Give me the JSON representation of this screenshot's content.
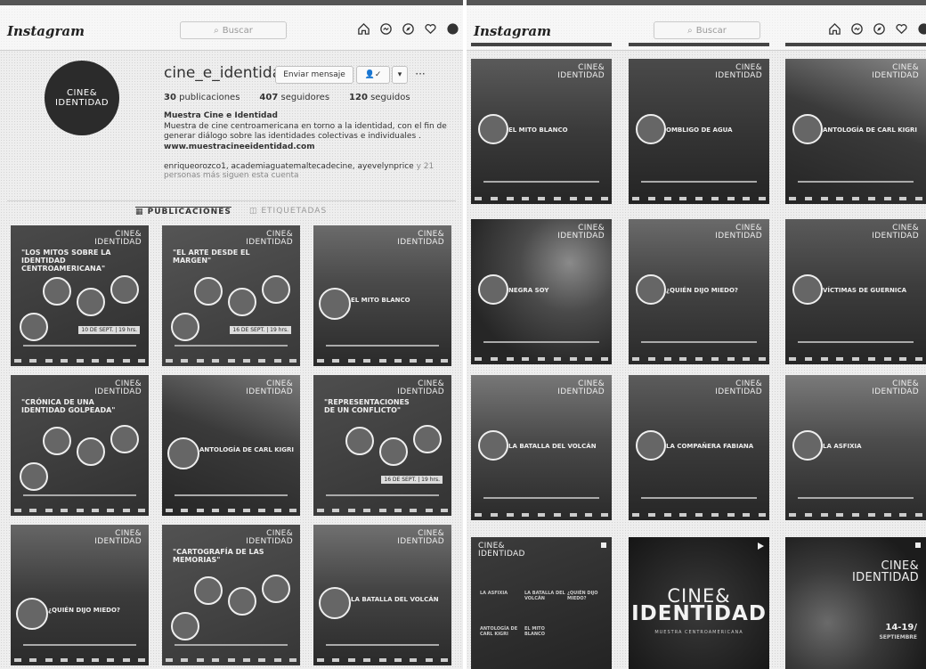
{
  "header": {
    "logo": "Instagram",
    "search_placeholder": "Buscar"
  },
  "profile": {
    "username": "cine_e_identidad",
    "message_button": "Enviar mensaje",
    "more": "···",
    "avatar_line1": "CINE&",
    "avatar_line2": "IDENTIDAD",
    "stats": {
      "posts_count": "30",
      "posts_label": "publicaciones",
      "followers_count": "407",
      "followers_label": "seguidores",
      "following_count": "120",
      "following_label": "seguidos"
    },
    "bio_name": "Muestra Cine e Identidad",
    "bio_text": "Muestra de cine centroamericana en torno a la identidad, con el fin de generar diálogo sobre las identidades colectivas e individuales .",
    "bio_link": "www.muestracineeidentidad.com",
    "followed_by": "enriqueorozco1, academiaguatemaltecadecine, ayevelynprice",
    "followed_more": "y 21",
    "followed_sub": "personas más siguen esta cuenta"
  },
  "tabs": {
    "posts": "PUBLICACIONES",
    "tagged": "ETIQUETADAS"
  },
  "brand": {
    "line1": "CINE&",
    "line2": "IDENTIDAD",
    "tagline": "MUESTRA CENTROAMERICANA"
  },
  "left_posts": [
    "\"LOS MITOS SOBRE LA IDENTIDAD CENTROAMERICANA\"",
    "\"EL ARTE DESDE EL MARGEN\"",
    "EL MITO BLANCO",
    "\"CRÓNICA DE UNA IDENTIDAD GOLPEADA\"",
    "ANTOLOGÍA DE CARL KIGRI",
    "\"REPRESENTACIONES DE UN CONFLICTO\"",
    "¿QUIÉN DIJO MIEDO?",
    "\"CARTOGRAFÍA DE LAS MEMORIAS\"",
    "LA BATALLA DEL VOLCÁN"
  ],
  "left_dates": [
    "10 DE SEPT. | 19 hrs.",
    "16 DE SEPT. | 19 hrs.",
    "16 DE SEPT. | 19 hrs."
  ],
  "right_posts": [
    "EL MITO BLANCO",
    "OMBLIGO DE AGUA",
    "ANTOLOGÍA DE CARL KIGRI",
    "NEGRA SOY",
    "¿QUIÉN DIJO MIEDO?",
    "VÍCTIMAS DE GUERNICA",
    "LA BATALLA DEL VOLCÁN",
    "LA COMPAÑERA FABIANA",
    "LA ASFIXIA"
  ],
  "schedule_titles": [
    "LA ASFIXIA",
    "LA BATALLA DEL VOLCÁN",
    "¿QUIÉN DIJO MIEDO?",
    "ANTOLOGÍA DE CARL KIGRI",
    "EL MITO BLANCO"
  ],
  "promo_dates": "14-19/",
  "promo_month": "SEPTIEMBRE"
}
